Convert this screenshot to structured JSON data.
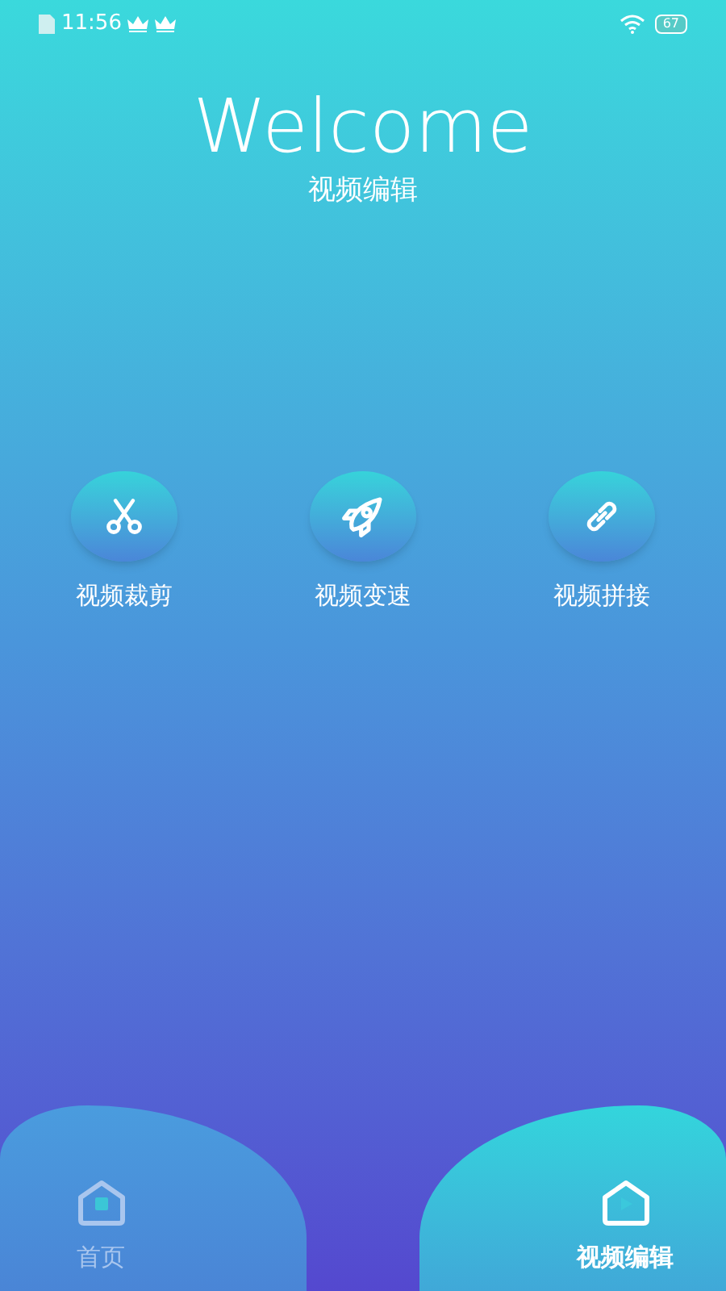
{
  "status_bar": {
    "time": "11:56",
    "battery": "67"
  },
  "header": {
    "title": "Welcome",
    "subtitle": "视频编辑"
  },
  "features": [
    {
      "kind": "scissors",
      "label": "视频裁剪"
    },
    {
      "kind": "rocket",
      "label": "视频变速"
    },
    {
      "kind": "link",
      "label": "视频拼接"
    }
  ],
  "tabs": [
    {
      "label": "首页",
      "selected": false
    },
    {
      "label": "视频编辑",
      "selected": true
    }
  ]
}
